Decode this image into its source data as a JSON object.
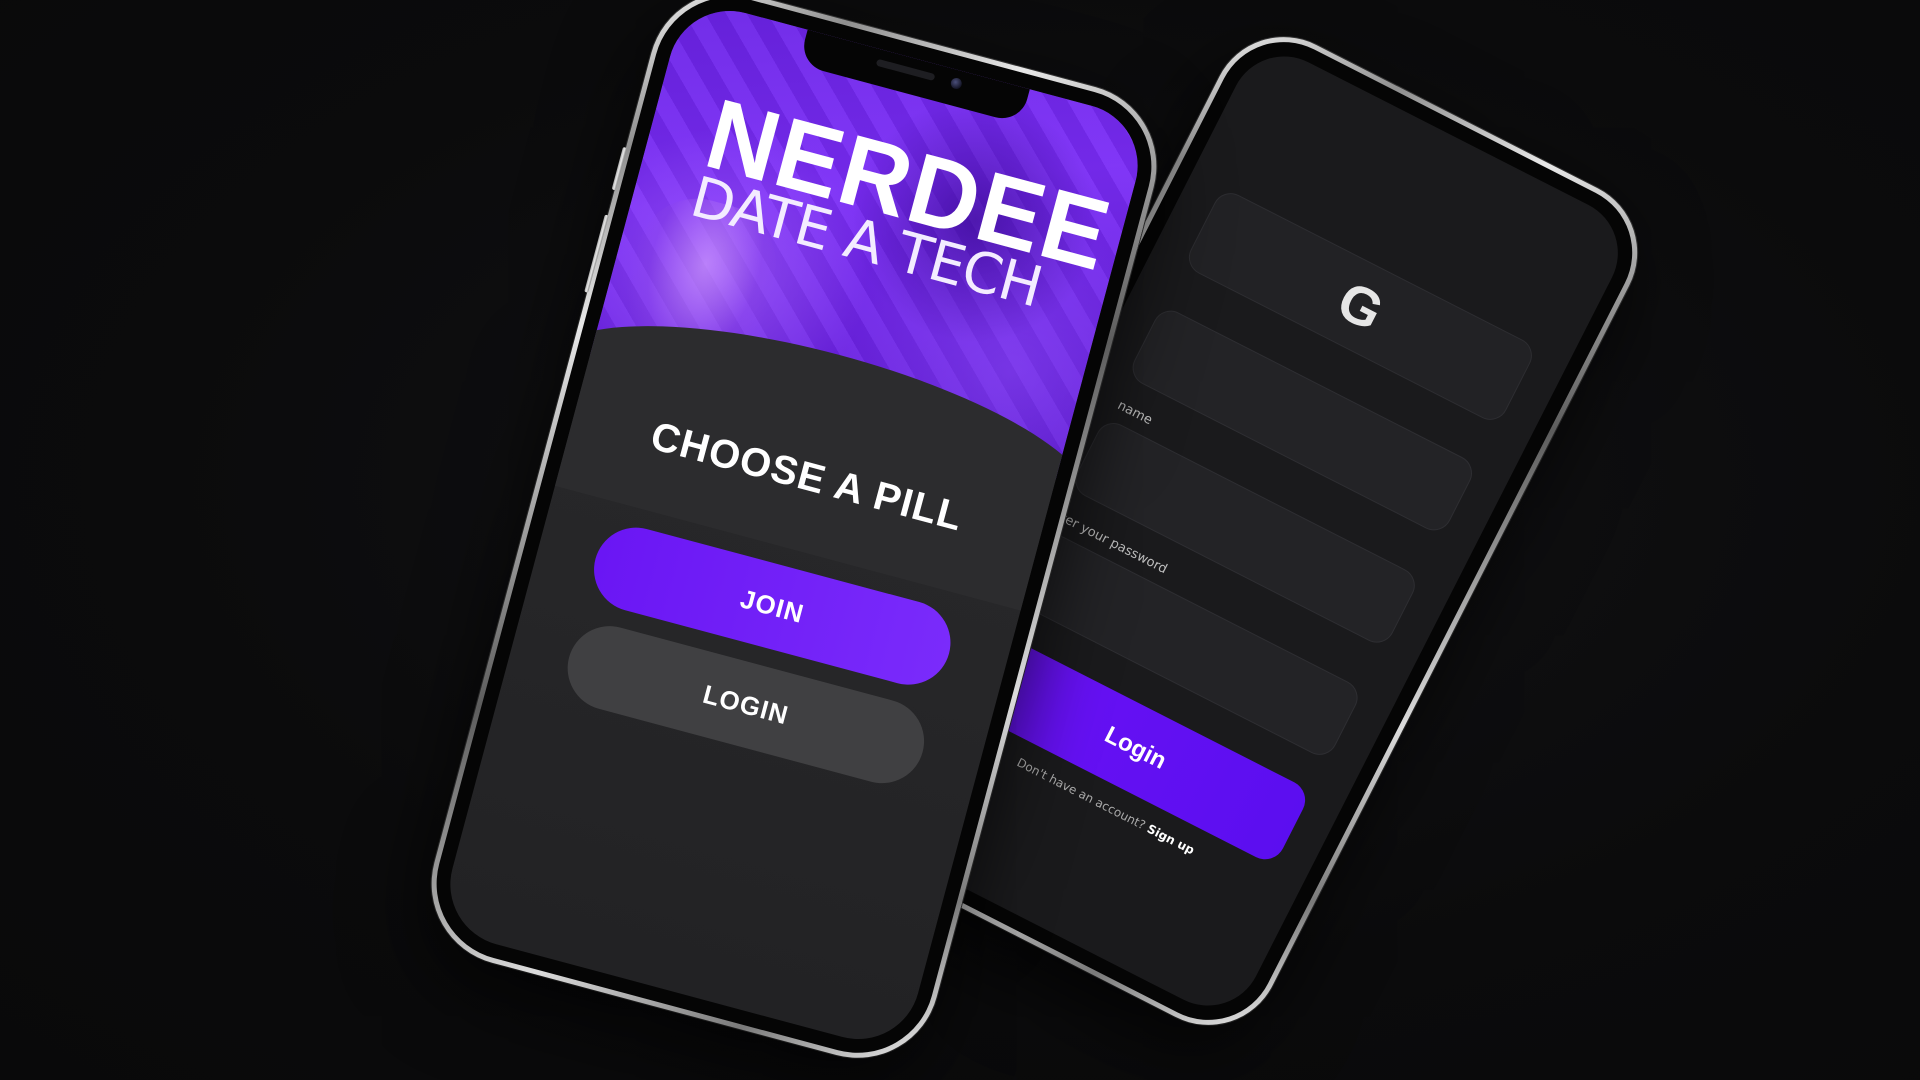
{
  "app": {
    "name": "NERDEE",
    "tagline": "DATE A TECH"
  },
  "welcome_screen": {
    "heading": "CHOOSE A PILL",
    "join_label": "JOIN",
    "login_label": "LOGIN"
  },
  "login_screen": {
    "social_button_letter": "G",
    "username_label": "name",
    "password_label": "ter your password",
    "login_label": "Login",
    "no_account_text": "Don't have an account?",
    "signup_link": "Sign up"
  },
  "colors": {
    "background": "#0b0b0c",
    "accent_purple": "#6a16f4",
    "screen_dark": "#2c2c2e",
    "secondary_button": "#404042"
  },
  "icons": {
    "social": "google-icon"
  }
}
